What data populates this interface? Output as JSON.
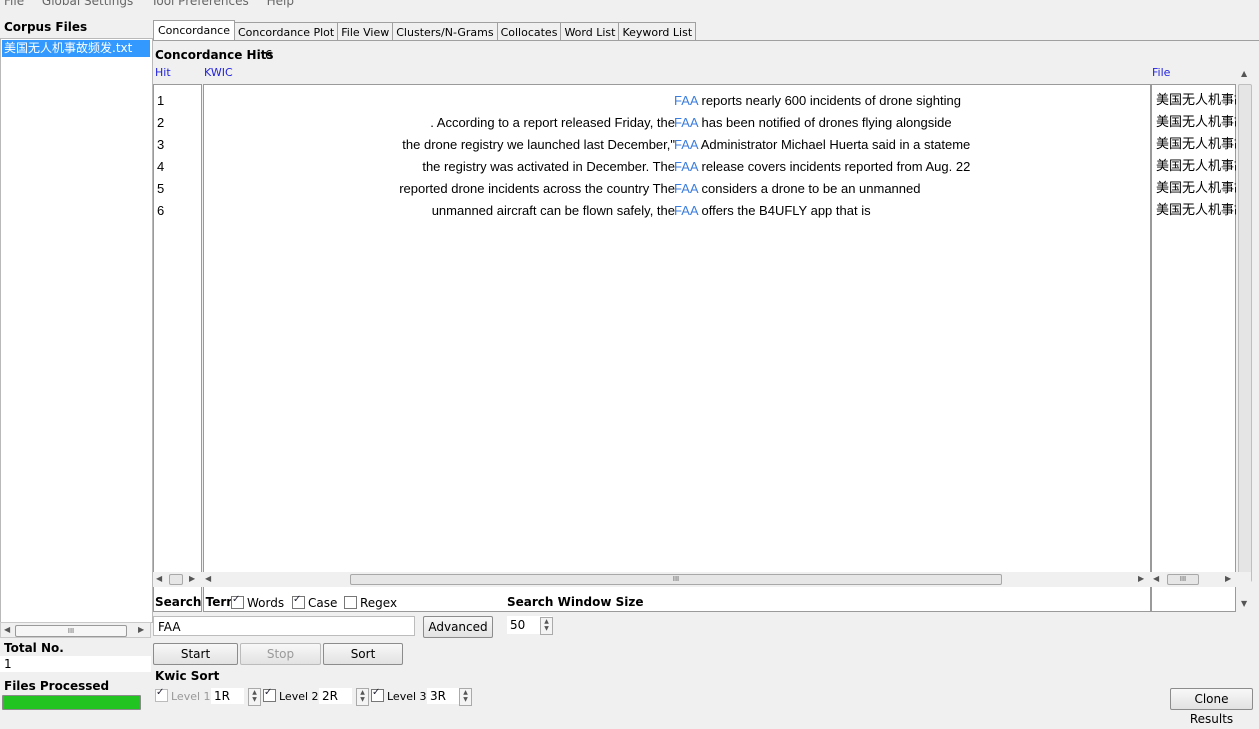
{
  "menu": [
    "File",
    "Global Settings",
    "Tool Preferences",
    "Help"
  ],
  "left_panel": {
    "corpus_files_label": "Corpus Files",
    "files": [
      "美国无人机事故频发.txt"
    ],
    "total_no_label": "Total No.",
    "total_no_value": "1",
    "files_processed_label": "Files Processed",
    "files_processed_progress": 1.0
  },
  "tabs": [
    "Concordance",
    "Concordance Plot",
    "File View",
    "Clusters/N-Grams",
    "Collocates",
    "Word List",
    "Keyword List"
  ],
  "active_tab": "Concordance",
  "concordance": {
    "hits_label": "Concordance Hits",
    "hits_value": "6",
    "columns": {
      "hit": "Hit",
      "kwic": "KWIC",
      "file": "File"
    },
    "rows": [
      {
        "hit": "1",
        "left": "",
        "keyword": "FAA",
        "right": "reports nearly 600 incidents of drone sighting",
        "file": "美国无人机事故频发.txt"
      },
      {
        "hit": "2",
        "left": ". According to a report released Friday, the",
        "keyword": "FAA",
        "right": "has been notified of drones flying alongside",
        "file": "美国无人机事故频发.txt"
      },
      {
        "hit": "3",
        "left": "the drone registry we launched last December,\"",
        "keyword": "FAA",
        "right": "Administrator Michael Huerta said in a stateme",
        "file": "美国无人机事故频发.txt"
      },
      {
        "hit": "4",
        "left": "the registry was activated in December. The",
        "keyword": "FAA",
        "right": "release covers incidents reported from Aug. 22",
        "file": "美国无人机事故频发.txt"
      },
      {
        "hit": "5",
        "left": "reported drone incidents across the country The",
        "keyword": "FAA",
        "right": "considers a drone to be an unmanned",
        "file": "美国无人机事故频发.txt"
      },
      {
        "hit": "6",
        "left": "unmanned aircraft can be flown safely, the",
        "keyword": "FAA",
        "right": "offers the B4UFLY app that is",
        "file": "美国无人机事故频发.txt"
      }
    ]
  },
  "search": {
    "term_label": "Search Term",
    "words_label": "Words",
    "words_checked": true,
    "case_label": "Case",
    "case_checked": true,
    "regex_label": "Regex",
    "regex_checked": false,
    "term_value": "FAA",
    "advanced_label": "Advanced",
    "window_size_label": "Search Window Size",
    "window_size_value": "50",
    "start_label": "Start",
    "stop_label": "Stop",
    "sort_label": "Sort"
  },
  "kwic_sort": {
    "label": "Kwic Sort",
    "level1_label": "Level 1",
    "level1_value": "1R",
    "level2_label": "Level 2",
    "level2_value": "2R",
    "level3_label": "Level 3",
    "level3_value": "3R"
  },
  "clone_results_label": "Clone Results",
  "scroll_grip": "III"
}
